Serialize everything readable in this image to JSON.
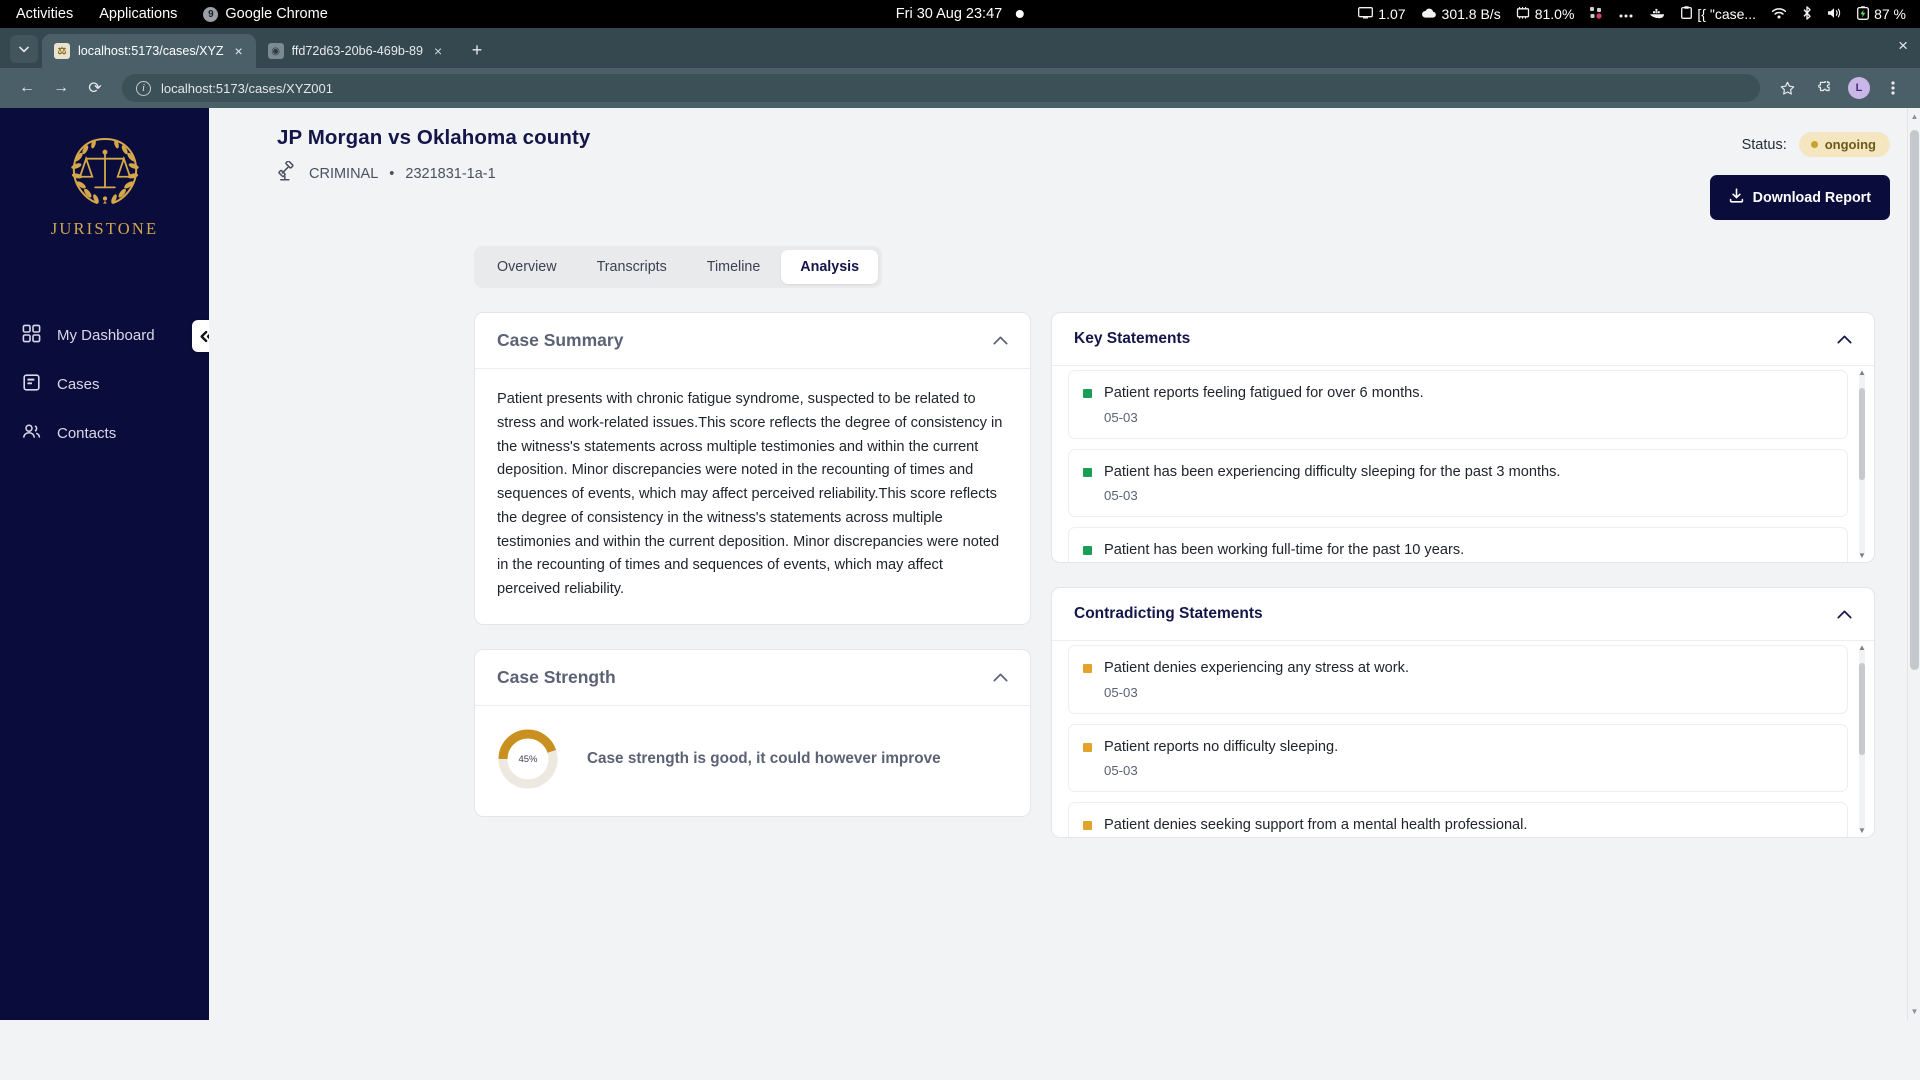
{
  "os_bar": {
    "activities": "Activities",
    "applications": "Applications",
    "app_name": "Google Chrome",
    "app_icon": "chrome-icon",
    "clock": "Fri 30 Aug  23:47",
    "recording_indicator": "record-dot-icon",
    "indicators": [
      {
        "icon": "display-icon",
        "text": "1.07"
      },
      {
        "icon": "cloud-network-icon",
        "text": "301.8 B/s"
      },
      {
        "icon": "cpu-icon",
        "text": "81.0%"
      },
      {
        "icon": "app-grid-icon",
        "text": ""
      },
      {
        "icon": "ellipsis-icon",
        "text": ""
      },
      {
        "icon": "docker-whale-icon",
        "text": ""
      },
      {
        "icon": "clipboard-icon",
        "text": "[{ \"case..."
      },
      {
        "icon": "wifi-icon",
        "text": ""
      },
      {
        "icon": "bluetooth-icon",
        "text": ""
      },
      {
        "icon": "volume-icon",
        "text": ""
      },
      {
        "icon": "battery-charging-icon",
        "text": "87 %"
      }
    ]
  },
  "browser": {
    "tab_list_icon": "chevron-down-icon",
    "tabs": [
      {
        "title": "localhost:5173/cases/XYZ",
        "favicon": "juristone-favicon",
        "active": true,
        "close": "×"
      },
      {
        "title": "ffd72d63-20b6-469b-89",
        "favicon": "generic-page-favicon",
        "active": false,
        "close": "×"
      }
    ],
    "new_tab": "+",
    "window_close": "×",
    "back": "←",
    "forward": "→",
    "reload": "⟳",
    "site_info_icon": "info-circle-icon",
    "url": "localhost:5173/cases/XYZ001",
    "bookmark_icon": "star-icon",
    "extensions_icon": "puzzle-icon",
    "profile_initial": "L",
    "menu_icon": "kebab-menu-icon"
  },
  "sidebar": {
    "brand": "JURISTONE",
    "logo_icon": "scales-of-justice-laurel-logo",
    "collapse_icon": "«",
    "items": [
      {
        "label": "My Dashboard",
        "icon": "dashboard-grid-icon"
      },
      {
        "label": "Cases",
        "icon": "case-file-icon"
      },
      {
        "label": "Contacts",
        "icon": "contacts-people-icon"
      }
    ]
  },
  "case": {
    "title": "JP Morgan vs Oklahoma county",
    "type_icon": "gavel-icon",
    "type": "CRIMINAL",
    "separator": "•",
    "number": "2321831-1a-1",
    "status_label": "Status:",
    "status_value": "ongoing",
    "status_color": "#c9a227",
    "download_label": "Download Report",
    "download_icon": "download-icon"
  },
  "tabs": [
    {
      "label": "Overview",
      "active": false
    },
    {
      "label": "Transcripts",
      "active": false
    },
    {
      "label": "Timeline",
      "active": false
    },
    {
      "label": "Analysis",
      "active": true
    }
  ],
  "case_summary": {
    "title": "Case Summary",
    "collapse_icon": "chevron-up-icon",
    "text": "Patient presents with chronic fatigue syndrome, suspected to be related to stress and work-related issues.This score reflects the degree of consistency in the witness's statements across multiple testimonies and within the current deposition. Minor discrepancies were noted in the recounting of times and sequences of events, which may affect perceived reliability.This score reflects the degree of consistency in the witness's statements across multiple testimonies and within the current deposition. Minor discrepancies were noted in the recounting of times and sequences of events, which may affect perceived reliability."
  },
  "case_strength": {
    "title": "Case Strength",
    "collapse_icon": "chevron-up-icon",
    "percent": "45%",
    "percent_value": 45,
    "gauge_color": "#c9901f",
    "gauge_track": "#ede8e0",
    "message": "Case strength is good, it could however improve"
  },
  "key_statements": {
    "title": "Key Statements",
    "collapse_icon": "chevron-up-icon",
    "marker_color": "#1a9d55",
    "items": [
      {
        "text": "Patient reports feeling fatigued for over 6 months.",
        "date": "05-03"
      },
      {
        "text": "Patient has been experiencing difficulty sleeping for the past 3 months.",
        "date": "05-03"
      },
      {
        "text": "Patient has been working full-time for the past 10 years.",
        "date": ""
      }
    ]
  },
  "contradicting_statements": {
    "title": "Contradicting Statements",
    "collapse_icon": "chevron-up-icon",
    "marker_color": "#e2a32b",
    "items": [
      {
        "text": "Patient denies experiencing any stress at work.",
        "date": "05-03"
      },
      {
        "text": "Patient reports no difficulty sleeping.",
        "date": "05-03"
      },
      {
        "text": "Patient denies seeking support from a mental health professional.",
        "date": ""
      }
    ]
  }
}
